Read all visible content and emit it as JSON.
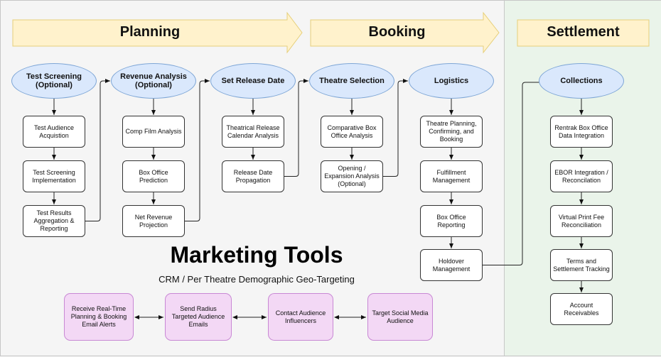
{
  "phases": [
    {
      "label": "Planning",
      "color": "#fff2cc"
    },
    {
      "label": "Booking",
      "color": "#fff2cc"
    },
    {
      "label": "Settlement",
      "color": "#fff2cc"
    }
  ],
  "columns": [
    {
      "header": "Test Screening (Optional)",
      "steps": [
        "Test Audience Acquistion",
        "Test Screening Implementation",
        "Test Results Aggregation & Reporting"
      ]
    },
    {
      "header": "Revenue Analysis (Optional)",
      "steps": [
        "Comp Film Analysis",
        "Box Office Prediction",
        "Net Revenue Projection"
      ]
    },
    {
      "header": "Set Release Date",
      "steps": [
        "Theatrical Release Calendar Analysis",
        "Release Date Propagation"
      ]
    },
    {
      "header": "Theatre Selection",
      "steps": [
        "Comparative Box Office Analysis",
        "Opening / Expansion Analysis (Optional)"
      ]
    },
    {
      "header": "Logistics",
      "steps": [
        "Theatre Planning, Confirming, and Booking",
        "Fulfillment Management",
        "Box Office Reporting",
        "Holdover Management"
      ]
    },
    {
      "header": "Collections",
      "steps": [
        "Rentrak Box Office Data Integration",
        "EBOR Integration / Reconcilation",
        "Virtual Print Fee Reconciliation",
        "Terms and Settlement Tracking",
        "Account Receivables"
      ]
    }
  ],
  "marketing": {
    "title": "Marketing Tools",
    "subtitle": "CRM / Per Theatre Demographic Geo-Targeting",
    "tools": [
      "Receive Real-Time Planning & Booking Email Alerts",
      "Send Radius Targeted Audience Emails",
      "Contact Audience Influencers",
      "Target Social Media Audience"
    ]
  },
  "colors": {
    "ellipse_fill": "#dae8fc",
    "ellipse_stroke": "#7ea6d6",
    "phase_fill": "#fff2cc",
    "phase_stroke": "#e6cf7a",
    "marketing_fill": "#f3d8f5",
    "settlement_bg": "#eaf4ea"
  }
}
